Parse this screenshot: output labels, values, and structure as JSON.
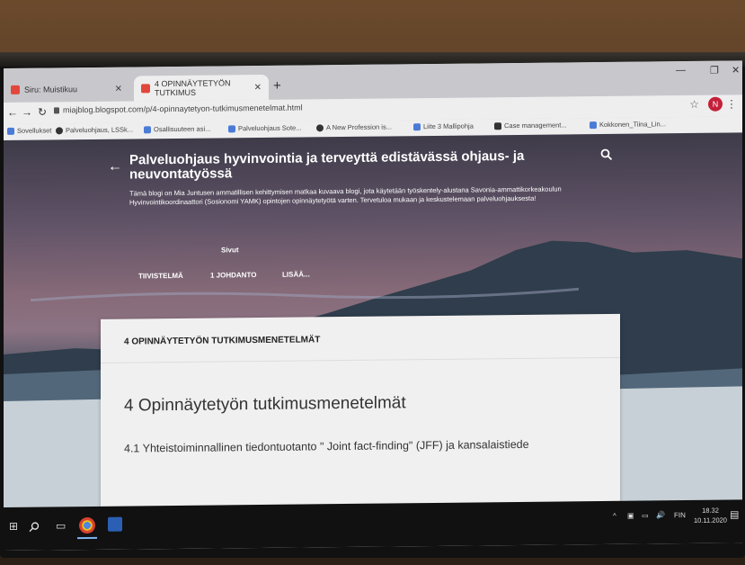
{
  "browser": {
    "tabs": [
      {
        "label": "Siru: Muistikuu",
        "active": false
      },
      {
        "label": "4 OPINNÄYTETYÖN TUTKIMUS",
        "active": true
      }
    ],
    "url": "miajblog.blogspot.com/p/4-opinnaytetyon-tutkimusmenetelmat.html",
    "avatar_letter": "N",
    "bookmarks": [
      {
        "label": "Sovellukset",
        "color": "#4a7bd6"
      },
      {
        "label": "Palveluohjaus, LSSk...",
        "color": "#333333"
      },
      {
        "label": "Osallisuuteen asi...",
        "color": "#4a7bd6"
      },
      {
        "label": "Palveluohjaus Sote...",
        "color": "#4a7bd6"
      },
      {
        "label": "A New Profession is...",
        "color": "#333333"
      },
      {
        "label": "Liite 3 Mallipohja",
        "color": "#4a7bd6"
      },
      {
        "label": "Case management...",
        "color": "#333333"
      },
      {
        "label": "Kokkonen_Tiina_Lin...",
        "color": "#4a7bd6"
      }
    ]
  },
  "blog": {
    "title": "Palveluohjaus hyvinvointia ja terveyttä edistävässä ohjaus- ja neuvontatyössä",
    "description": "Tämä blogi on Mia Juntusen ammatillisen kehittymisen matkaa kuvaava blogi, jota käytetään työskentely-alustana Savonia-ammattikorkeakoulun Hyvinvointikoordinaattori (Sosionomi YAMK) opintojen opinnäytetyötä varten. Tervetuloa mukaan ja keskustelemaan palveluohjauksesta!",
    "pages_label": "Sivut",
    "nav": [
      "TIIVISTELMÄ",
      "1 JOHDANTO",
      "LISÄÄ..."
    ]
  },
  "post": {
    "header_title": "4 OPINNÄYTETYÖN TUTKIMUSMENETELMÄT",
    "heading": "4 Opinnäytetyön tutkimusmenetelmät",
    "subheading": "4.1 Yhteistoiminnallinen tiedontuotanto \" Joint fact-finding\" (JFF) ja kansalaistiede"
  },
  "taskbar": {
    "language": "FIN",
    "time": "18.32",
    "date": "10.11.2020"
  },
  "colors": {
    "accent_red": "#e1483b",
    "profile_red": "#c4203a"
  }
}
